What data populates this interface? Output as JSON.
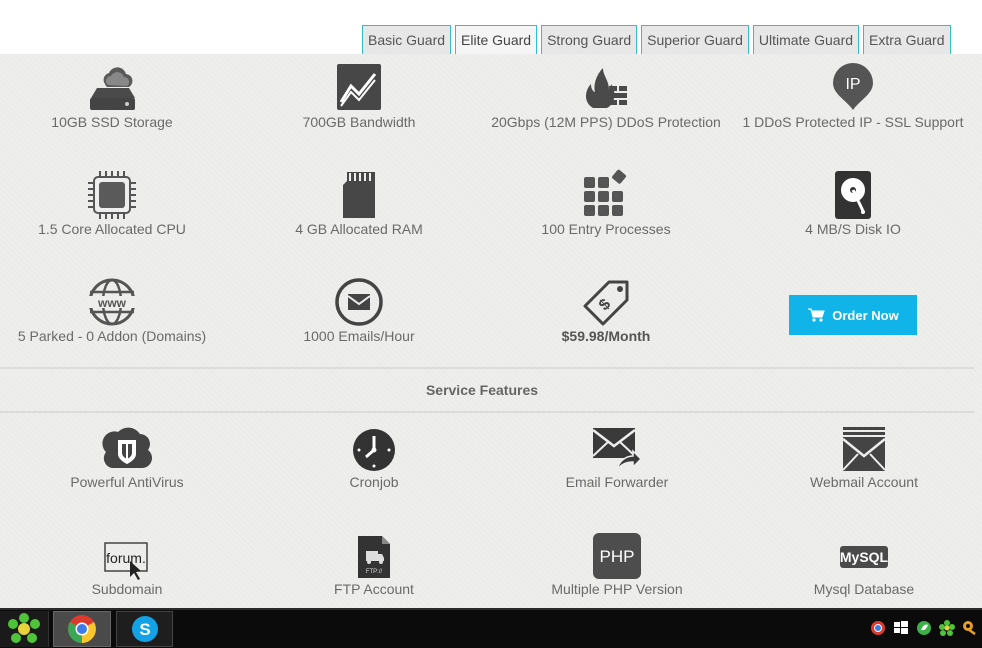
{
  "tabs": [
    {
      "label": "Basic Guard"
    },
    {
      "label": "Elite Guard"
    },
    {
      "label": "Strong Guard"
    },
    {
      "label": "Superior Guard"
    },
    {
      "label": "Ultimate Guard"
    },
    {
      "label": "Extra Guard"
    }
  ],
  "active_tab": "Elite Guard",
  "plan_features": {
    "row1": [
      "10GB SSD Storage",
      "700GB Bandwidth",
      "20Gbps (12M PPS) DDoS Protection",
      "1 DDoS Protected IP - SSL Support"
    ],
    "row2": [
      "1.5 Core Allocated CPU",
      "4 GB Allocated RAM",
      "100 Entry Processes",
      "4 MB/S Disk IO"
    ],
    "row3": [
      "5 Parked - 0 Addon (Domains)",
      "1000 Emails/Hour",
      "$59.98/Month"
    ]
  },
  "ip_icon_text": "IP",
  "order_button": "Order Now",
  "section_title": "Service Features",
  "service_features": {
    "row1": [
      "Powerful AntiVirus",
      "Cronjob",
      "Email Forwarder",
      "Webmail Account"
    ],
    "row2": [
      "Subdomain",
      "FTP Account",
      "Multiple PHP Version",
      "Mysql Database"
    ]
  },
  "icon_text": {
    "www": "www",
    "forum": "forum.",
    "php": "PHP",
    "mysql": "MySQL",
    "ftp": "FTP://"
  },
  "colors": {
    "tab_border": "#30c0cc",
    "order_button": "#11b4e8",
    "icon": "#444444"
  }
}
